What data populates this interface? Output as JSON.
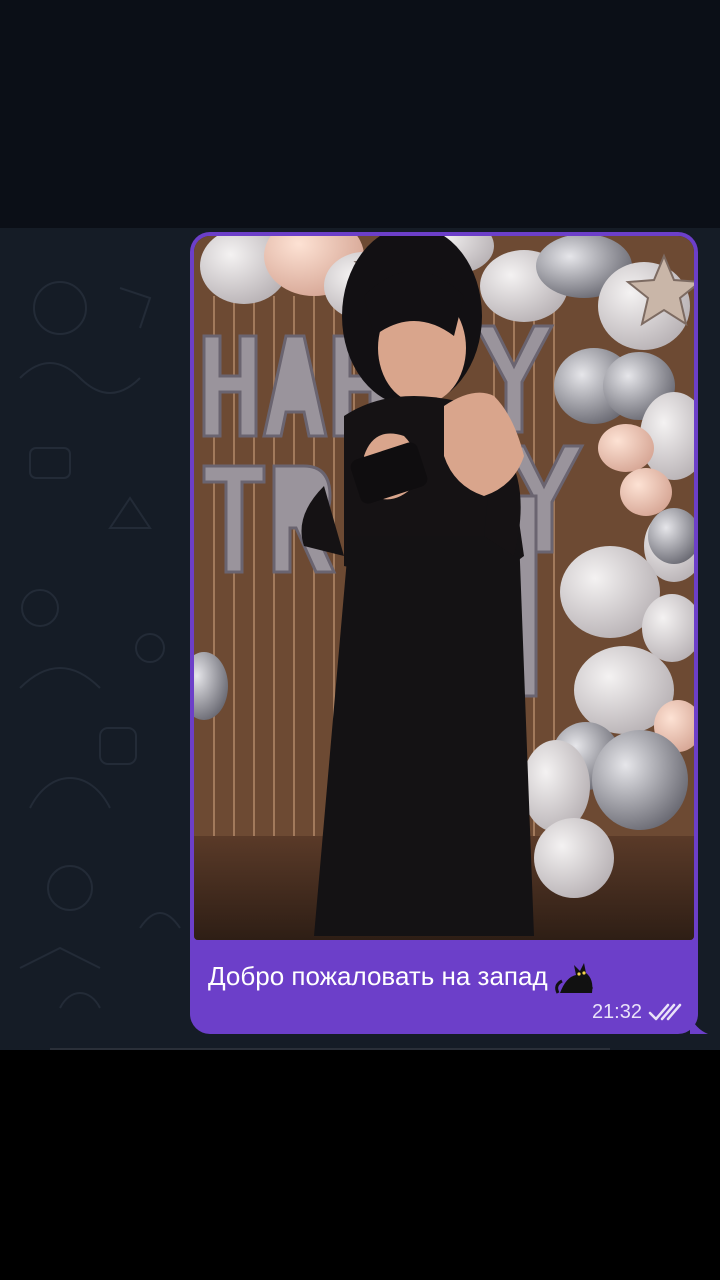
{
  "message": {
    "caption": "Добро пожаловать на запад",
    "time": "21:32",
    "status": "read",
    "status_icon": "double-check-icon",
    "emoji_icon": "black-cat-icon",
    "media_type": "video"
  },
  "colors": {
    "bubble": "#6c3fc9",
    "chat_background": "#151c26",
    "caption_text": "#ffffff"
  }
}
